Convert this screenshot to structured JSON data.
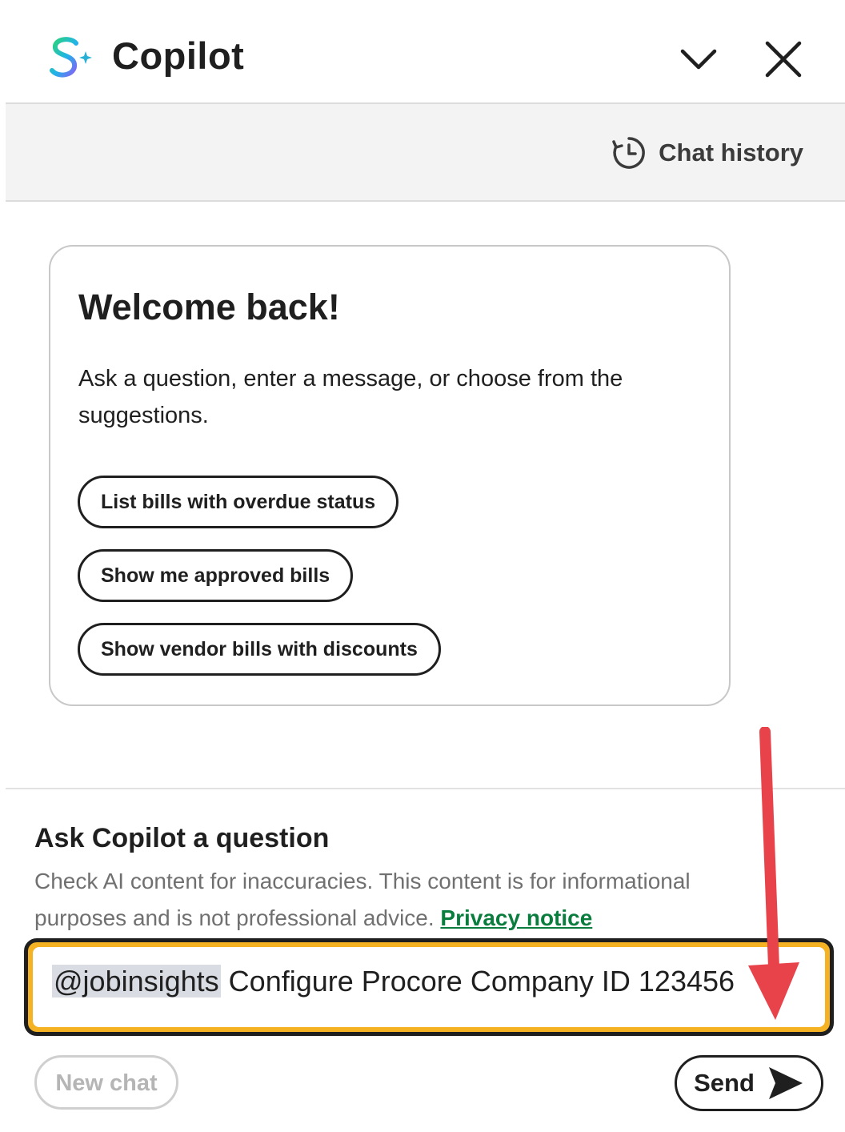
{
  "header": {
    "title": "Copilot",
    "logo_icon": "copilot-logo-icon",
    "collapse_icon": "chevron-down-icon",
    "close_icon": "close-icon"
  },
  "history_bar": {
    "label": "Chat history",
    "icon": "history-clock-icon"
  },
  "welcome_card": {
    "title": "Welcome back!",
    "text": "Ask a question, enter a message, or choose from the suggestions.",
    "suggestions": [
      "List bills with overdue status",
      "Show me approved bills",
      "Show vendor bills with discounts"
    ]
  },
  "composer": {
    "title": "Ask Copilot a question",
    "disclaimer": "Check AI content for inaccuracies. This content is for informational purposes and is not professional advice.",
    "privacy_link": "Privacy notice",
    "input": {
      "mention": "@jobinsights",
      "value": "Configure Procore Company ID 123456"
    },
    "new_chat_label": "New chat",
    "send_label": "Send",
    "send_icon": "send-arrow-icon"
  },
  "colors": {
    "accent_input_border": "#f5b324",
    "privacy_link": "#0a7d3e",
    "annotation_arrow": "#e8434a",
    "mention_highlight": "#d9dde3"
  }
}
